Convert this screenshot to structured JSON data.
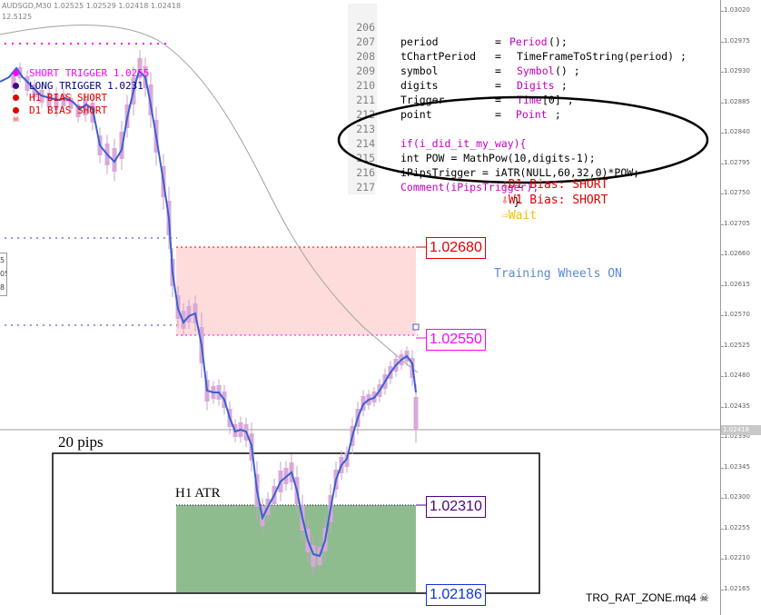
{
  "header": {
    "symbol_line": "AUDSGD,M30  1.02525 1.02529 1.02418 1.02418",
    "indicator_line": "12.5125"
  },
  "legend": [
    {
      "label": "SHORT TRIGGER  1.0255",
      "color": "#ff00ff",
      "dot_color": "#ff00ff"
    },
    {
      "label": "LONG TRIGGER   1.0231",
      "color": "#000080",
      "dot_color": "#4b0082"
    },
    {
      "label": "H1 BIAS SHORT",
      "color": "#e00000",
      "dot_color": "#e00000"
    },
    {
      "label": "D1 BIAS SHORT",
      "color": "#e00000",
      "dot_color": "#e00000"
    }
  ],
  "legend_skull": "☠",
  "left_box_values": [
    "5",
    "05",
    "8"
  ],
  "code": [
    {
      "num": "206",
      "var": "period",
      "eq": "=",
      "expr": "Period();",
      "expr_kw": "Period",
      "rest": "();"
    },
    {
      "num": "207",
      "var": "tChartPeriod",
      "eq": "=",
      "expr_kw": "",
      "rest": "TimeFrameToString(period) ;"
    },
    {
      "num": "208",
      "var": "symbol",
      "eq": "=",
      "expr_kw": "Symbol",
      "rest": "() ;"
    },
    {
      "num": "209",
      "var": "digits",
      "eq": "=",
      "expr_kw": "Digits",
      "rest": " ;"
    },
    {
      "num": "210",
      "var": "Trigger",
      "eq": "=",
      "expr_kw": "Time",
      "rest": "[0] ;"
    },
    {
      "num": "211",
      "var": "point",
      "eq": "=",
      "expr_kw": " Point",
      "rest": " ;"
    },
    {
      "num": "212",
      "var": "",
      "eq": "",
      "expr_kw": "",
      "rest": ""
    },
    {
      "num": "213",
      "text": "if(i_did_it_my_way){"
    },
    {
      "num": "214",
      "text": "int POW = MathPow(10,digits-1);"
    },
    {
      "num": "215",
      "text": "iPipsTrigger = iATR(NULL,60,32,0)*POW;"
    },
    {
      "num": "216",
      "text": "Comment(iPipsTrigger);"
    },
    {
      "num": "217",
      "text": "                  }"
    }
  ],
  "bias": [
    {
      "arrow": "⇩",
      "label": "D1 Bias: SHORT",
      "color": "#e00000"
    },
    {
      "arrow": "⇩",
      "label": "W1 Bias: SHORT",
      "color": "#e00000"
    },
    {
      "arrow": "⇨",
      "label": "Wait",
      "color": "#f0c000"
    }
  ],
  "training_wheels": "Training Wheels ON",
  "price_labels": {
    "upper_zone_top": "1.02680",
    "short_trigger": "1.02550",
    "long_trigger": "1.02310",
    "lower_zone_bottom": "1.02186"
  },
  "annotations": {
    "pips": "20 pips",
    "atr": "H1 ATR"
  },
  "footer": "TRO_RAT_ZONE.mq4 ☠",
  "price_axis": {
    "ticks": [
      "1.03020",
      "1.02975",
      "1.02930",
      "1.02885",
      "1.02840",
      "1.02795",
      "1.02750",
      "1.02705",
      "1.02660",
      "1.02615",
      "1.02570",
      "1.02525",
      "1.02480",
      "1.02435",
      "1.02390",
      "1.02345",
      "1.02300",
      "1.02255",
      "1.02210",
      "1.02165"
    ],
    "current": "1.02418"
  },
  "colors": {
    "short_zone": "#ffdcdc",
    "long_zone": "#8fbc8f",
    "ma_line": "#3a5fd0",
    "candles": "#d9a8d9",
    "short_trigger": "#ff00ff",
    "long_trigger": "#4b0082"
  }
}
